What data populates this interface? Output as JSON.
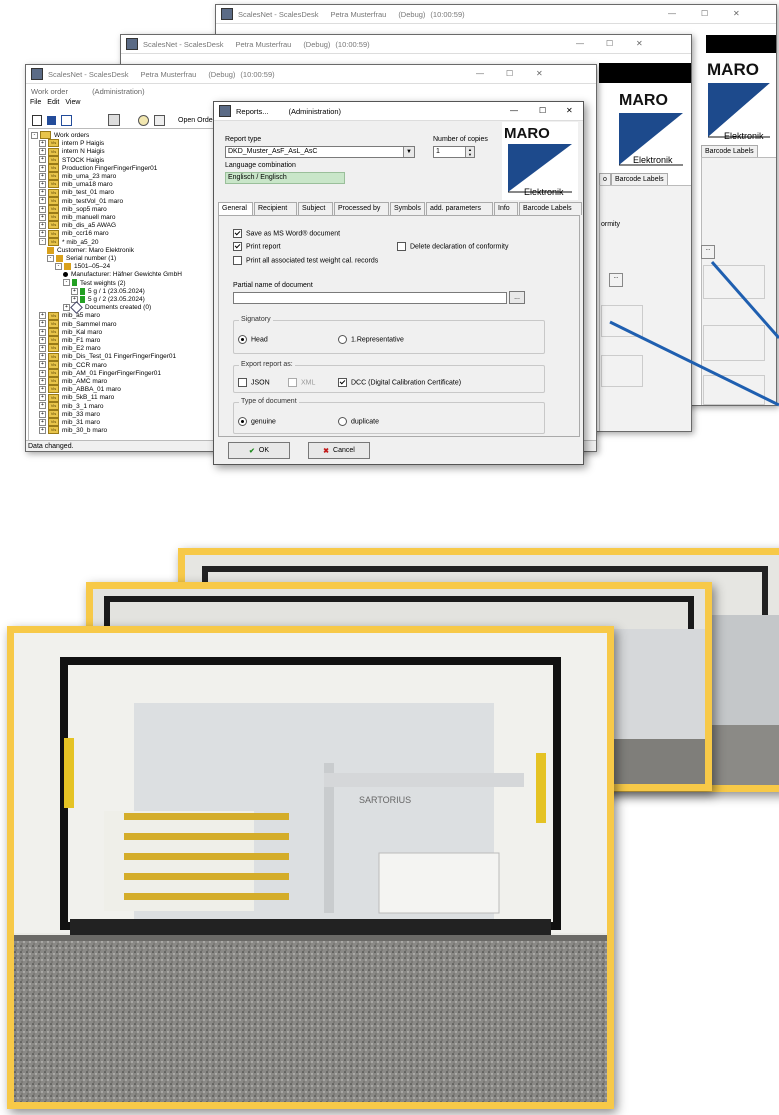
{
  "back_window_1": {
    "title": "ScalesNet - ScalesDesk",
    "user": "Petra Musterfrau",
    "mode": "(Debug)",
    "time": "(10:00:59)",
    "tab_label": "Barcode Labels",
    "logo_top": "MARO",
    "logo_bottom": "Elektronik"
  },
  "back_window_2": {
    "title": "ScalesNet - ScalesDesk",
    "user": "Petra Musterfrau",
    "mode": "(Debug)",
    "time": "(10:00:59)",
    "tab_partial": "o",
    "tab_label": "Barcode Labels",
    "side_text": "ormity",
    "logo_top": "MARO",
    "logo_bottom": "Elektronik"
  },
  "main_window": {
    "title": "ScalesNet - ScalesDesk",
    "user": "Petra Musterfrau",
    "mode": "(Debug)",
    "time": "(10:00:59)",
    "sub_title": "Work order",
    "sub_context": "(Administration)",
    "menu": [
      "File",
      "Edit",
      "View"
    ],
    "toolbar_label": "Open Orders",
    "status": "Data changed.",
    "tree": [
      {
        "indent": 0,
        "icon": "folder-work",
        "text": "Work orders",
        "exp": "-"
      },
      {
        "indent": 1,
        "icon": "vis",
        "text": "intern P  Haigis",
        "exp": "+"
      },
      {
        "indent": 1,
        "icon": "vis",
        "text": "intern N  Haigis",
        "exp": "+"
      },
      {
        "indent": 1,
        "icon": "vis",
        "text": "STOCK  Haigis",
        "exp": "+"
      },
      {
        "indent": 1,
        "icon": "vis",
        "text": "Production  FingerFingerFinger01",
        "exp": "+"
      },
      {
        "indent": 1,
        "icon": "vis",
        "text": "mib_uma_23  maro",
        "exp": "+"
      },
      {
        "indent": 1,
        "icon": "vis",
        "text": "mib_uma18  maro",
        "exp": "+"
      },
      {
        "indent": 1,
        "icon": "vis",
        "text": "mib_test_01  maro",
        "exp": "+"
      },
      {
        "indent": 1,
        "icon": "vis",
        "text": "mib_testVol_01  maro",
        "exp": "+"
      },
      {
        "indent": 1,
        "icon": "vis",
        "text": "mib_sop5  maro",
        "exp": "+"
      },
      {
        "indent": 1,
        "icon": "vis",
        "text": "mib_manuell  maro",
        "exp": "+"
      },
      {
        "indent": 1,
        "icon": "vis",
        "text": "mib_dis_a5  AWAG",
        "exp": "+"
      },
      {
        "indent": 1,
        "icon": "vis",
        "text": "mib_ccr16  maro",
        "exp": "+"
      },
      {
        "indent": 1,
        "icon": "vis",
        "text": "* mib_a5_20",
        "exp": "-"
      },
      {
        "indent": 2,
        "icon": "customer",
        "text": "Customer: Maro Elektronik",
        "exp": ""
      },
      {
        "indent": 2,
        "icon": "serial",
        "text": "Serial number (1)",
        "exp": "-"
      },
      {
        "indent": 3,
        "icon": "date",
        "text": "1501–05–24",
        "exp": "-"
      },
      {
        "indent": 4,
        "icon": "dot",
        "text": "Manufacturer: Häfner Gewichte GmbH",
        "exp": ""
      },
      {
        "indent": 4,
        "icon": "weights",
        "text": "Test weights (2)",
        "exp": "-"
      },
      {
        "indent": 5,
        "icon": "weight",
        "text": "5 g / 1 (23.05.2024)",
        "exp": "+"
      },
      {
        "indent": 5,
        "icon": "weight",
        "text": "5 g / 2 (23.05.2024)",
        "exp": "+"
      },
      {
        "indent": 4,
        "icon": "docs",
        "text": "Documents created (0)",
        "exp": "+"
      },
      {
        "indent": 1,
        "icon": "vis",
        "text": "mib_a5  maro",
        "exp": "+"
      },
      {
        "indent": 1,
        "icon": "vis",
        "text": "mib_Sammel  maro",
        "exp": "+"
      },
      {
        "indent": 1,
        "icon": "vis",
        "text": "mib_Kal  maro",
        "exp": "+"
      },
      {
        "indent": 1,
        "icon": "vis",
        "text": "mib_F1  maro",
        "exp": "+"
      },
      {
        "indent": 1,
        "icon": "vis",
        "text": "mib_E2  maro",
        "exp": "+"
      },
      {
        "indent": 1,
        "icon": "vis",
        "text": "mib_Dis_Test_01  FingerFingerFinger01",
        "exp": "+"
      },
      {
        "indent": 1,
        "icon": "vis",
        "text": "mib_CCR  maro",
        "exp": "+"
      },
      {
        "indent": 1,
        "icon": "vis",
        "text": "mib_AM_01  FingerFingerFinger01",
        "exp": "+"
      },
      {
        "indent": 1,
        "icon": "vis",
        "text": "mib_AMC  maro",
        "exp": "+"
      },
      {
        "indent": 1,
        "icon": "vis",
        "text": "mib_ABBA_01  maro",
        "exp": "+"
      },
      {
        "indent": 1,
        "icon": "vis",
        "text": "mib_5kB_11  maro",
        "exp": "+"
      },
      {
        "indent": 1,
        "icon": "vis",
        "text": "mib_3_1  maro",
        "exp": "+"
      },
      {
        "indent": 1,
        "icon": "vis",
        "text": "mib_33  maro",
        "exp": "+"
      },
      {
        "indent": 1,
        "icon": "vis",
        "text": "mib_31  maro",
        "exp": "+"
      },
      {
        "indent": 1,
        "icon": "vis",
        "text": "mib_30_b  maro",
        "exp": "+"
      }
    ]
  },
  "dialog": {
    "title": "Reports...",
    "context": "(Administration)",
    "report_type_label": "Report type",
    "report_type_value": "DKD_Muster_AsF_AsL_AsC",
    "copies_label": "Number of copies",
    "copies_value": "1",
    "language_label": "Language combination",
    "language_value": "Englisch / Englisch",
    "logo_top": "MARO",
    "logo_bottom": "Elektronik",
    "tabs": [
      "General",
      "Recipient",
      "Subject",
      "Processed by",
      "Symbols",
      "add. parameters",
      "Info",
      "Barcode Labels"
    ],
    "save_word": "Save as MS Word® document",
    "print_report": "Print report",
    "delete_conformity": "Delete declaration of conformity",
    "print_all": "Print all associated test weight cal. records",
    "partial_name_label": "Partial name of document",
    "partial_name_value": "",
    "browse": "...",
    "signatory_title": "Signatory",
    "signatory_head": "Head",
    "signatory_rep": "1.Representative",
    "export_title": "Export report as:",
    "export_json": "JSON",
    "export_xml": "XML",
    "export_dcc": "DCC (Digital Calibration Certificate)",
    "doc_type_title": "Type of document",
    "doc_genuine": "genuine",
    "doc_duplicate": "duplicate",
    "ok": "OK",
    "cancel": "Cancel"
  },
  "colors": {
    "frame": "#f7c948",
    "arrow": "#1f5fb0",
    "language_bg": "#c9e6c9",
    "black": "#000000"
  },
  "photo_captions": {
    "brand": "SARTORIUS"
  }
}
